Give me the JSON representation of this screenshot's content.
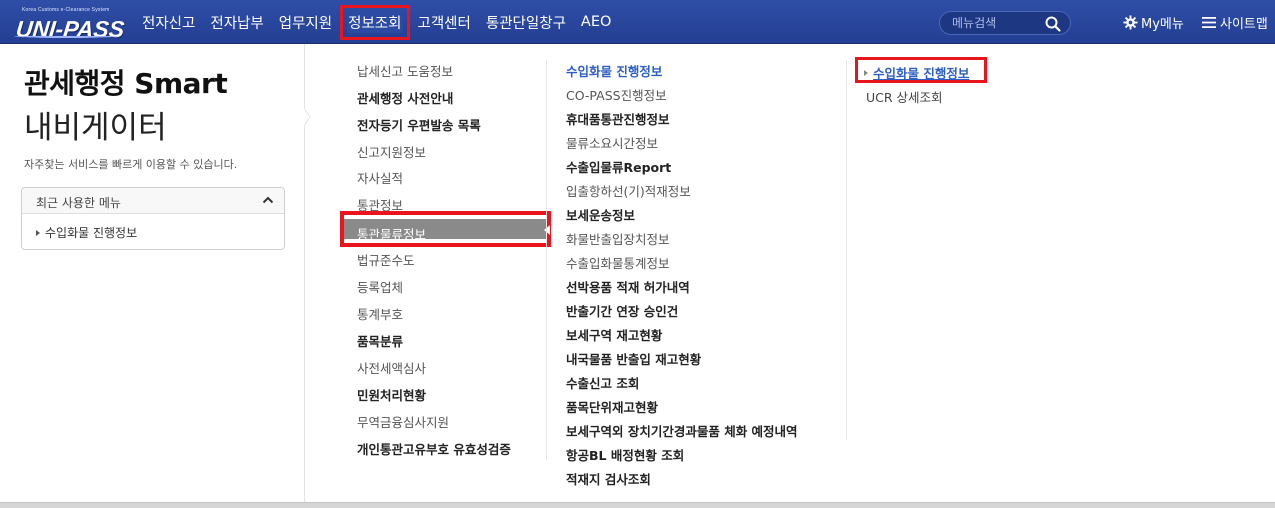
{
  "logo": {
    "tagline": "Korea Customs e-Clearance System",
    "word": "UNI-PASS"
  },
  "nav": {
    "items": [
      "전자신고",
      "전자납부",
      "업무지원",
      "정보조회",
      "고객센터",
      "통관단일창구",
      "AEO"
    ],
    "active_index": 3
  },
  "search": {
    "placeholder": "메뉴검색",
    "icon": "search-icon"
  },
  "my_menu": {
    "label": "My메뉴",
    "icon": "gear-icon"
  },
  "sitemap": {
    "label": "사이트맵",
    "icon": "hamburger-icon"
  },
  "left_panel": {
    "title_line1": "관세행정 Smart",
    "title_line2": "내비게이터",
    "description": "자주찾는 서비스를 빠르게 이용할 수 있습니다.",
    "recent_menu": {
      "header": "최근 사용한 메뉴",
      "items": [
        "수입화물 진행정보"
      ]
    }
  },
  "column1": {
    "items": [
      {
        "label": "납세신고 도움정보",
        "bold": false
      },
      {
        "label": "관세행정 사전안내",
        "bold": true
      },
      {
        "label": "전자등기 우편발송 목록",
        "bold": true
      },
      {
        "label": "신고지원정보",
        "bold": false
      },
      {
        "label": "자사실적",
        "bold": false
      },
      {
        "label": "통관정보",
        "bold": false
      },
      {
        "label": "통관물류정보",
        "bold": false
      },
      {
        "label": "법규준수도",
        "bold": false
      },
      {
        "label": "등록업체",
        "bold": false
      },
      {
        "label": "통계부호",
        "bold": false
      },
      {
        "label": "품목분류",
        "bold": true
      },
      {
        "label": "사전세액심사",
        "bold": false
      },
      {
        "label": "민원처리현황",
        "bold": true
      },
      {
        "label": "무역금융심사지원",
        "bold": false
      },
      {
        "label": "개인통관고유부호 유효성검증",
        "bold": true
      }
    ],
    "active_index": 6
  },
  "column2": {
    "items": [
      {
        "label": "수입화물 진행정보",
        "bold": true
      },
      {
        "label": "CO-PASS진행정보",
        "bold": false
      },
      {
        "label": "휴대품통관진행정보",
        "bold": true
      },
      {
        "label": "물류소요시간정보",
        "bold": false
      },
      {
        "label": "수출입물류Report",
        "bold": true
      },
      {
        "label": "입출항하선(기)적재정보",
        "bold": false
      },
      {
        "label": "보세운송정보",
        "bold": true
      },
      {
        "label": "화물반출입장치정보",
        "bold": false
      },
      {
        "label": "수출입화물통계정보",
        "bold": false
      },
      {
        "label": "선박용품 적재 허가내역",
        "bold": true
      },
      {
        "label": "반출기간 연장 승인건",
        "bold": true
      },
      {
        "label": "보세구역 재고현황",
        "bold": true
      },
      {
        "label": "내국물품 반출입 재고현황",
        "bold": true
      },
      {
        "label": "수출신고 조회",
        "bold": true
      },
      {
        "label": "품목단위재고현황",
        "bold": true
      },
      {
        "label": "보세구역외 장치기간경과물품 체화 예정내역",
        "bold": true
      },
      {
        "label": "항공BL 배정현황 조회",
        "bold": true
      },
      {
        "label": "적재지 검사조회",
        "bold": true
      }
    ],
    "active_index": 0
  },
  "column3": {
    "items": [
      "수입화물 진행정보",
      "UCR 상세조회"
    ],
    "active_index": 0
  },
  "colors": {
    "navbar": "#2a4aa3",
    "highlight": "#e8141e",
    "link_active": "#2f5fc4"
  }
}
